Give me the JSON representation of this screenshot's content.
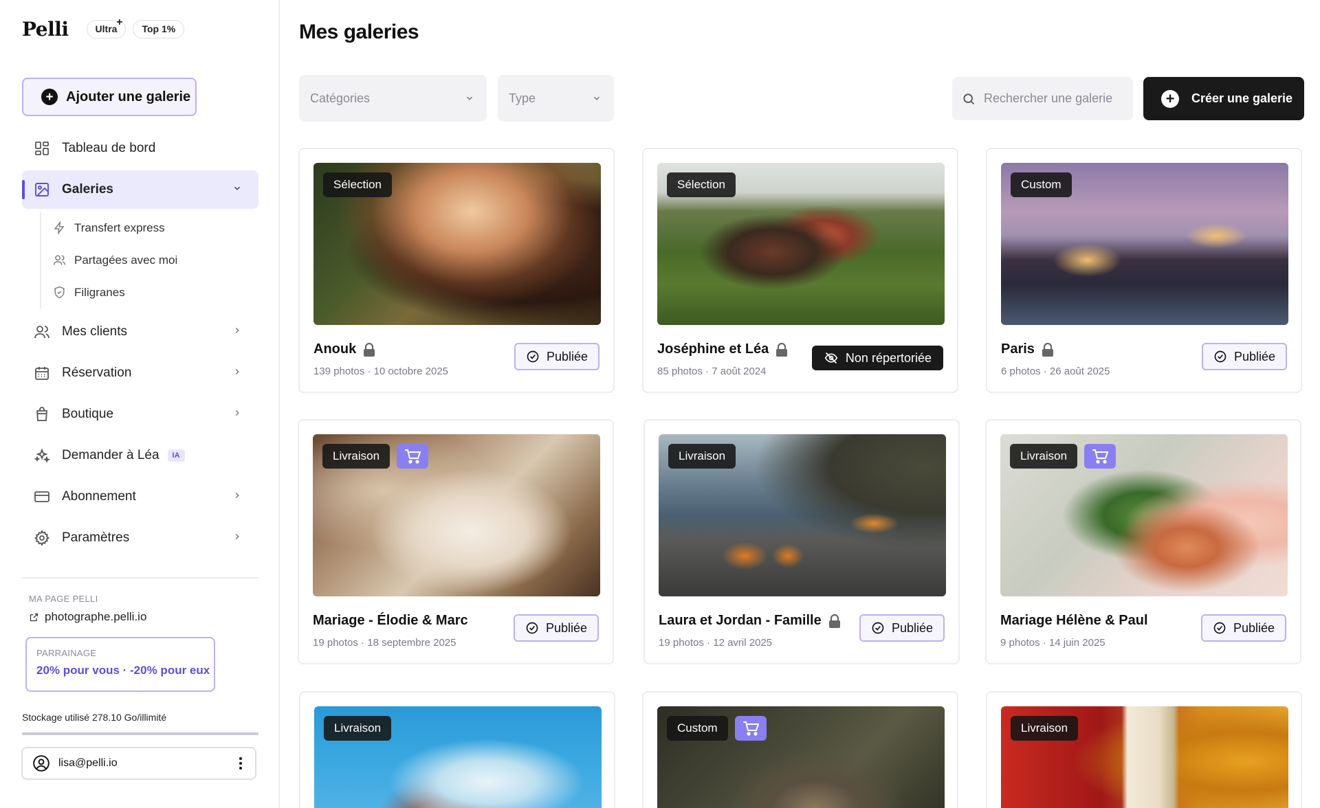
{
  "brand": {
    "logo": "Pelli",
    "badges": [
      {
        "label": "Ultra",
        "plus": "+"
      },
      {
        "label": "Top 1%"
      }
    ]
  },
  "sidebar": {
    "add_gallery_label": "Ajouter une galerie",
    "items": [
      {
        "label": "Tableau de bord",
        "icon": "dashboard-icon"
      },
      {
        "label": "Galeries",
        "icon": "gallery-icon",
        "active": true
      },
      {
        "label": "Mes clients",
        "icon": "users-icon"
      },
      {
        "label": "Réservation",
        "icon": "calendar-icon"
      },
      {
        "label": "Boutique",
        "icon": "shopping-bag-icon"
      },
      {
        "label": "Demander à Léa",
        "icon": "sparkles-icon",
        "badge": "IA"
      },
      {
        "label": "Abonnement",
        "icon": "credit-card-icon"
      },
      {
        "label": "Paramètres",
        "icon": "gear-icon"
      }
    ],
    "sub_items": [
      {
        "label": "Transfert express",
        "icon": "lightning-icon"
      },
      {
        "label": "Partagées avec moi",
        "icon": "shared-users-icon"
      },
      {
        "label": "Filigranes",
        "icon": "shield-icon"
      }
    ],
    "my_page": {
      "label": "MA PAGE PELLI",
      "link": "photographe.pelli.io"
    },
    "referral": {
      "label": "PARRAINAGE",
      "text": "20% pour vous · -20% pour eux"
    },
    "storage": {
      "text": "Stockage utilisé 278.10 Go/illimité"
    },
    "account": {
      "email": "lisa@pelli.io"
    }
  },
  "main": {
    "title": "Mes galeries",
    "filters": {
      "categories": "Catégories",
      "type": "Type"
    },
    "search_placeholder": "Rechercher une galerie",
    "create_label": "Créer une galerie"
  },
  "galleries": [
    {
      "name": "Anouk",
      "locked": true,
      "photos": "139 photos",
      "date": "10 octobre 2025",
      "tag": "Sélection",
      "shop": false,
      "status": "Publiée"
    },
    {
      "name": "Joséphine et Léa",
      "locked": true,
      "photos": "85 photos",
      "date": "7 août 2024",
      "tag": "Sélection",
      "shop": false,
      "status": "Non répertoriée"
    },
    {
      "name": "Paris",
      "locked": true,
      "photos": "6 photos",
      "date": "26 août 2025",
      "tag": "Custom",
      "shop": false,
      "status": "Publiée"
    },
    {
      "name": "Mariage - Élodie & Marc",
      "locked": false,
      "photos": "19 photos",
      "date": "18 septembre 2025",
      "tag": "Livraison",
      "shop": true,
      "status": "Publiée"
    },
    {
      "name": "Laura et Jordan - Famille",
      "locked": true,
      "photos": "19 photos",
      "date": "12 avril 2025",
      "tag": "Livraison",
      "shop": false,
      "status": "Publiée"
    },
    {
      "name": "Mariage Hélène & Paul",
      "locked": false,
      "photos": "9 photos",
      "date": "14 juin 2025",
      "tag": "Livraison",
      "shop": true,
      "status": "Publiée"
    },
    {
      "tag": "Livraison",
      "shop": false
    },
    {
      "tag": "Custom",
      "shop": true
    },
    {
      "tag": "Livraison",
      "shop": false
    }
  ],
  "colors": {
    "accent": "#5a4fe0",
    "accent_border": "#b8b3ef",
    "active_bg": "#ebe9fc",
    "dark": "#1a1a1a"
  }
}
